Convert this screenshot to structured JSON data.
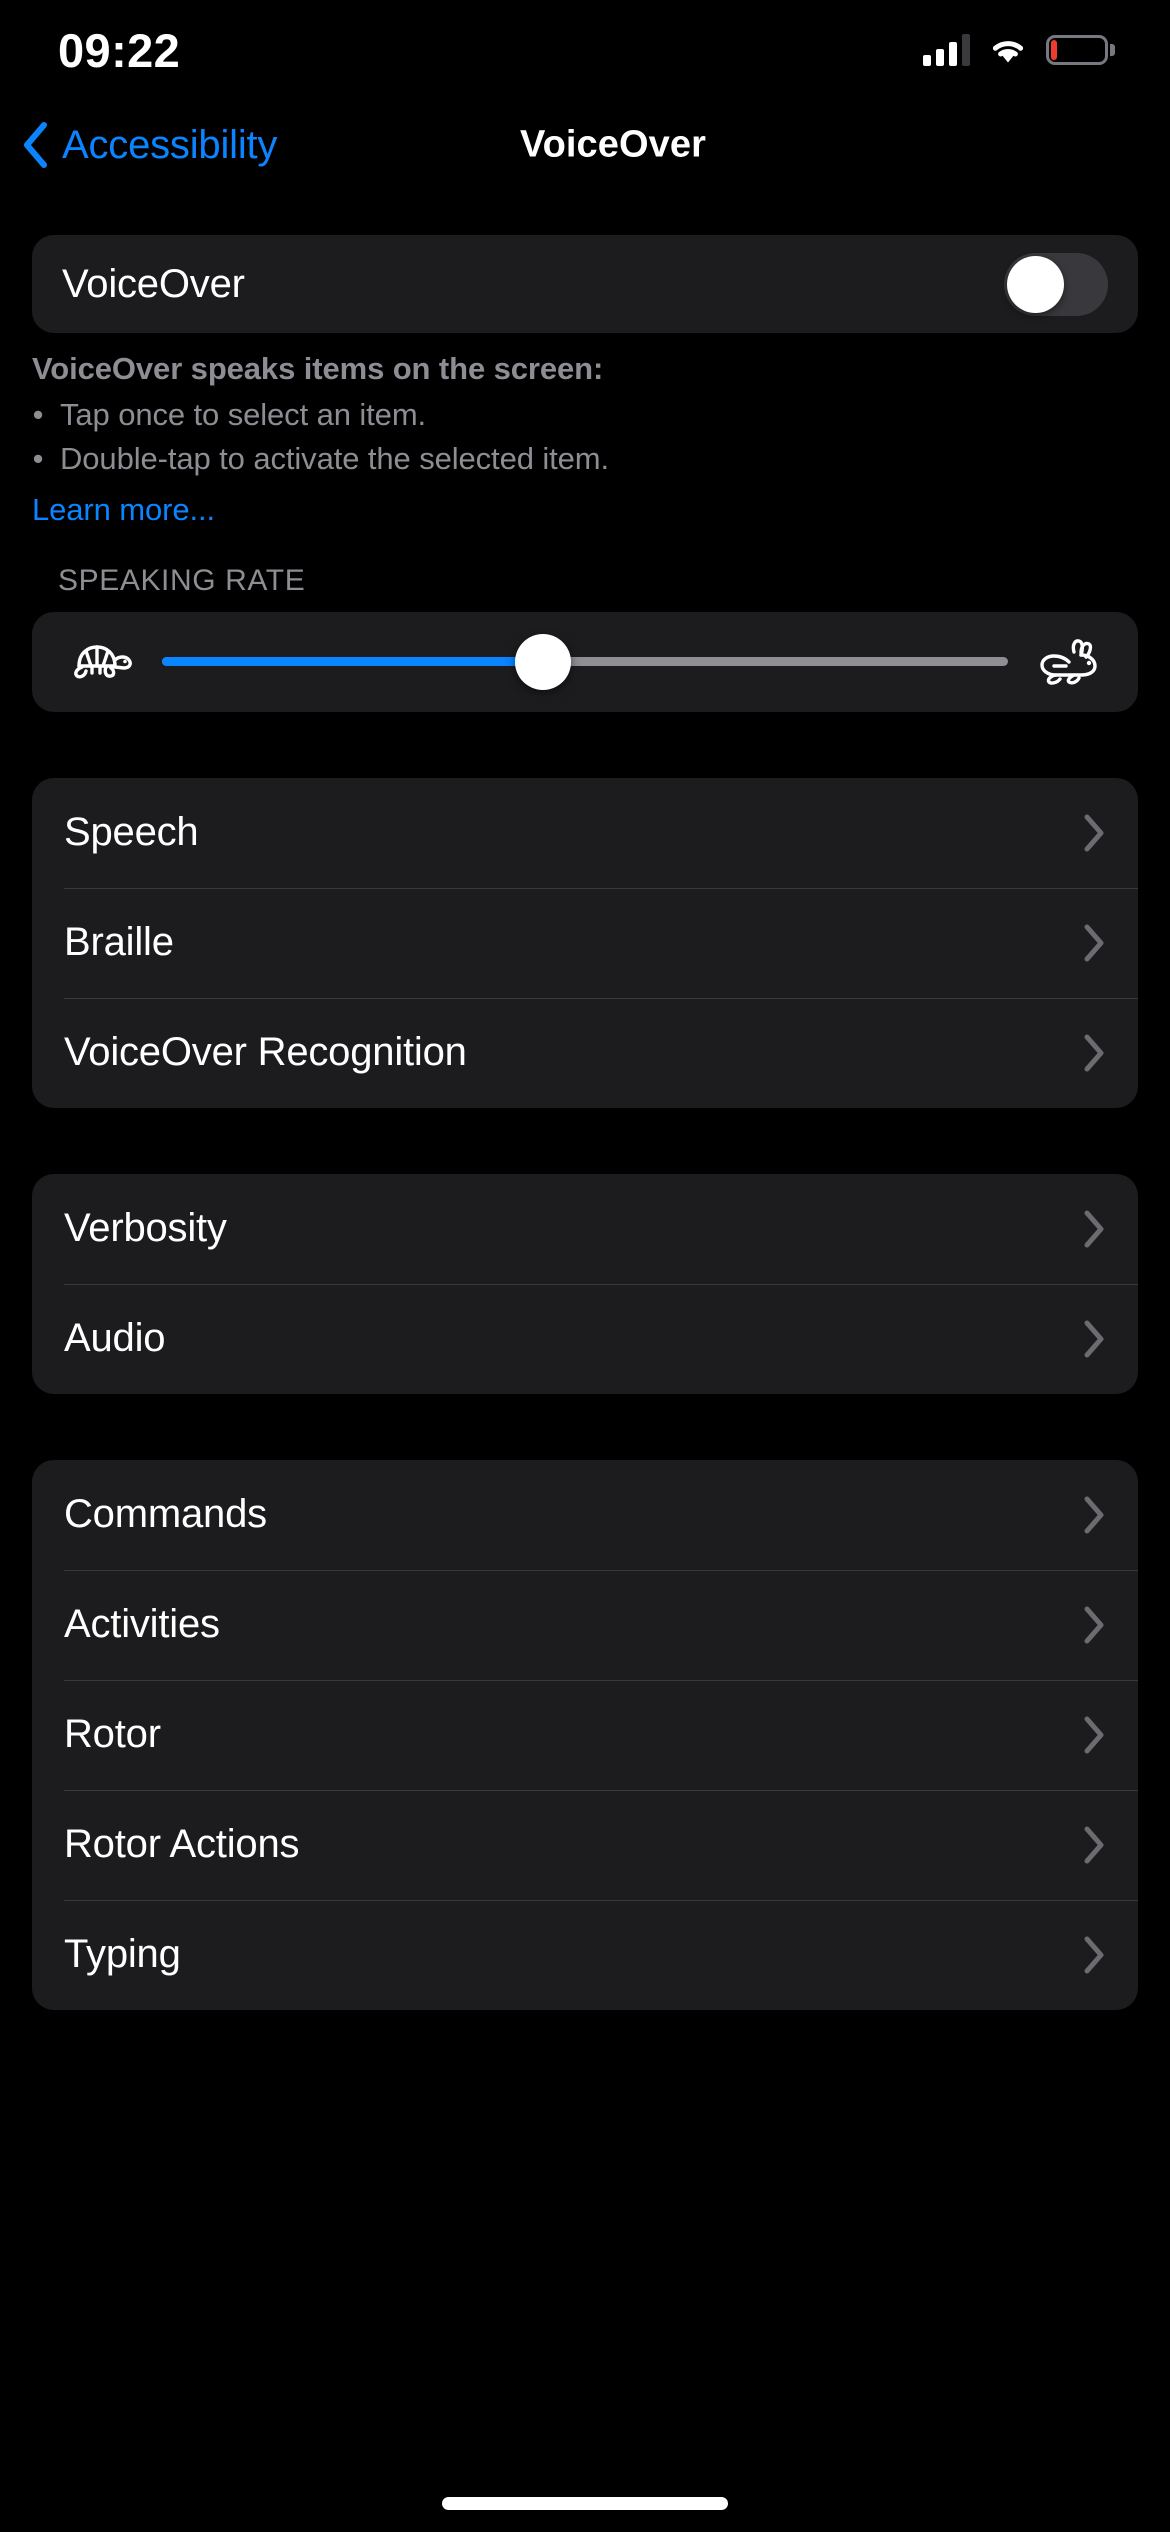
{
  "status_bar": {
    "time": "09:22",
    "cellular_icon": "cellular-signal-icon",
    "wifi_icon": "wifi-icon",
    "battery_icon": "battery-low-icon",
    "battery_level_percent": 12,
    "battery_color": "#f03c2e"
  },
  "nav": {
    "back_label": "Accessibility",
    "back_icon": "chevron-left-icon",
    "title": "VoiceOver",
    "accent_color": "#0a84ff"
  },
  "voiceover_toggle": {
    "label": "VoiceOver",
    "state": "off",
    "track_color": "#39393d"
  },
  "description": {
    "title": "VoiceOver speaks items on the screen:",
    "bullets": [
      "Tap once to select an item.",
      "Double-tap to activate the selected item."
    ],
    "link_label": "Learn more..."
  },
  "speaking_rate": {
    "section_header": "SPEAKING RATE",
    "slow_icon": "turtle-icon",
    "fast_icon": "rabbit-icon",
    "value_percent": 45,
    "fill_color": "#0a84ff",
    "rail_color": "#8e8e93"
  },
  "groups": [
    {
      "rows": [
        {
          "label": "Speech",
          "chevron": "chevron-right-icon"
        },
        {
          "label": "Braille",
          "chevron": "chevron-right-icon"
        },
        {
          "label": "VoiceOver Recognition",
          "chevron": "chevron-right-icon"
        }
      ]
    },
    {
      "rows": [
        {
          "label": "Verbosity",
          "chevron": "chevron-right-icon"
        },
        {
          "label": "Audio",
          "chevron": "chevron-right-icon"
        }
      ]
    },
    {
      "rows": [
        {
          "label": "Commands",
          "chevron": "chevron-right-icon"
        },
        {
          "label": "Activities",
          "chevron": "chevron-right-icon"
        },
        {
          "label": "Rotor",
          "chevron": "chevron-right-icon"
        },
        {
          "label": "Rotor Actions",
          "chevron": "chevron-right-icon"
        },
        {
          "label": "Typing",
          "chevron": "chevron-right-icon"
        }
      ]
    }
  ],
  "home_indicator": "home-indicator"
}
